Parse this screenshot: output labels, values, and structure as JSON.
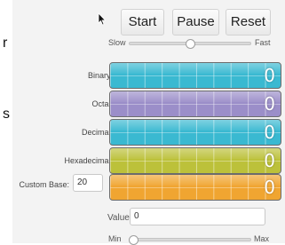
{
  "stray_text": {
    "top_letter": "r",
    "bottom_letter": "s"
  },
  "controls": {
    "start_label": "Start",
    "pause_label": "Pause",
    "reset_label": "Reset",
    "speed_slider": {
      "min_label": "Slow",
      "max_label": "Fast",
      "level": 0.5
    }
  },
  "displays": [
    {
      "label": "Binary:",
      "value": "0",
      "color": "#3ab9d1"
    },
    {
      "label": "Octal:",
      "value": "0",
      "color": "#9b8ec9"
    },
    {
      "label": "Decimal:",
      "value": "0",
      "color": "#3ab9d1"
    },
    {
      "label": "Hexadecimal:",
      "value": "0",
      "color": "#bcc13a"
    },
    {
      "label": "Custom Base:",
      "value": "0",
      "color": "#f0a531"
    }
  ],
  "custom_base": {
    "value": "20"
  },
  "value_field": {
    "label": "Value:",
    "value": "0"
  },
  "value_slider": {
    "min_label": "Min",
    "max_label": "Max",
    "level": 0.0
  }
}
